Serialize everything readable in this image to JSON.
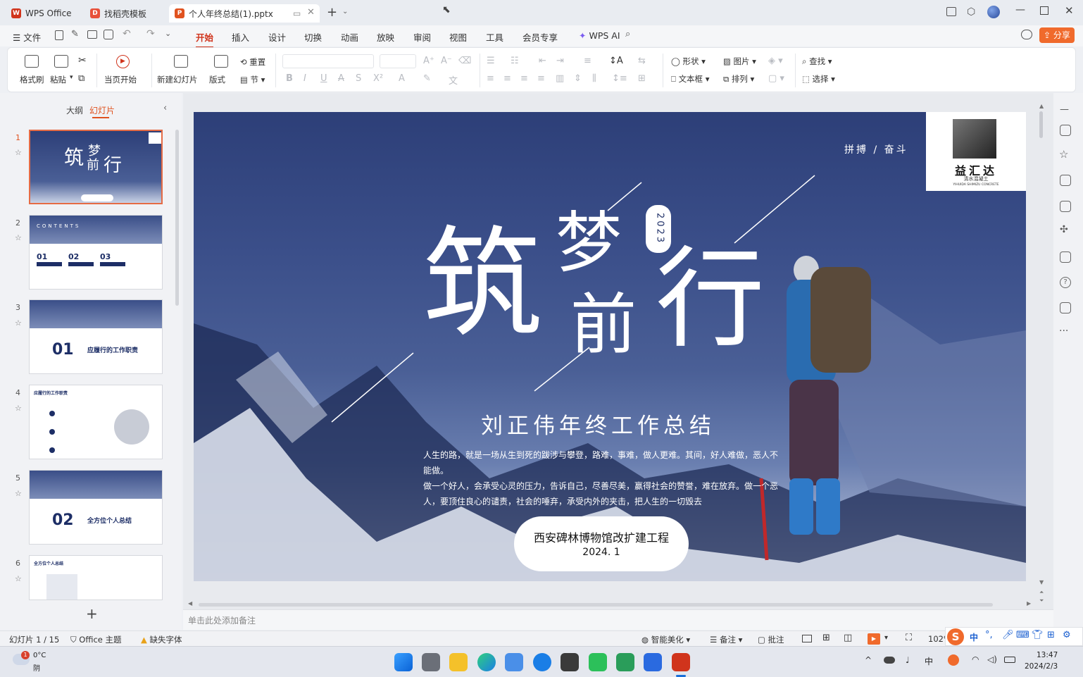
{
  "tabs": [
    {
      "label": "WPS Office",
      "color": "#d0341c"
    },
    {
      "label": "找稻壳模板",
      "color": "#e8503a"
    },
    {
      "label": "个人年终总结(1).pptx",
      "color": "#e0521f"
    }
  ],
  "menu": {
    "file": "文件",
    "items": [
      "开始",
      "插入",
      "设计",
      "切换",
      "动画",
      "放映",
      "审阅",
      "视图",
      "工具",
      "会员专享"
    ],
    "ai": "WPS AI",
    "share": "分享"
  },
  "ribbon": {
    "format_painter": "格式刷",
    "paste": "粘贴",
    "from_current": "当页开始",
    "new_slide": "新建幻灯片",
    "layout": "版式",
    "reset": "重置",
    "section": "节",
    "shape": "形状",
    "picture": "图片",
    "find": "查找",
    "textbox": "文本框",
    "arrange": "排列",
    "select": "选择"
  },
  "panel": {
    "outline_tab": "大纲",
    "slides_tab": "幻灯片",
    "numbers": [
      "1",
      "2",
      "3",
      "4",
      "5",
      "6"
    ],
    "thumb2": {
      "contents": "CONTENTS",
      "n1": "01",
      "n2": "02",
      "n3": "03"
    },
    "thumb3": {
      "num": "01",
      "title": "应履行的工作职责"
    },
    "thumb4": {
      "title": "应履行的工作职责"
    },
    "thumb5": {
      "num": "02",
      "title": "全方位个人总结"
    },
    "thumb6": {
      "title": "全方位个人总结"
    }
  },
  "slide": {
    "motto": "拼搏 / 奋斗",
    "char1": "筑",
    "char2": "梦",
    "char3": "前",
    "char4": "行",
    "year": "2023",
    "subtitle": "刘正伟年终工作总结",
    "body1": "人生的路，就是一场从生到死的跋涉与攀登，路难，事难，做人更难。其间，好人难做，恶人不能做。",
    "body2": "做一个好人，会承受心灵的压力，告诉自己，尽善尽美，赢得社会的赞誉，难在放弃。做一个恶人，要顶住良心的谴责，社会的唾弃，承受内外的夹击，把人生的一切毁去",
    "project": "西安碑林博物馆改扩建工程",
    "date": "2024. 1",
    "logo_name": "益汇达",
    "logo_sub": "清水混凝土",
    "logo_en": "YIHUIDA SHIMIZU CONCRETE"
  },
  "notes_placeholder": "单击此处添加备注",
  "status": {
    "slide_count": "幻灯片 1 / 15",
    "theme": "Office 主题",
    "missing_font": "缺失字体",
    "beautify": "智能美化",
    "notes": "备注",
    "comments": "批注",
    "zoom": "102%"
  },
  "taskbar": {
    "temp": "0°C",
    "weather": "阴",
    "badge": "1",
    "ime": "中",
    "time": "13:47",
    "date": "2024/2/3"
  }
}
